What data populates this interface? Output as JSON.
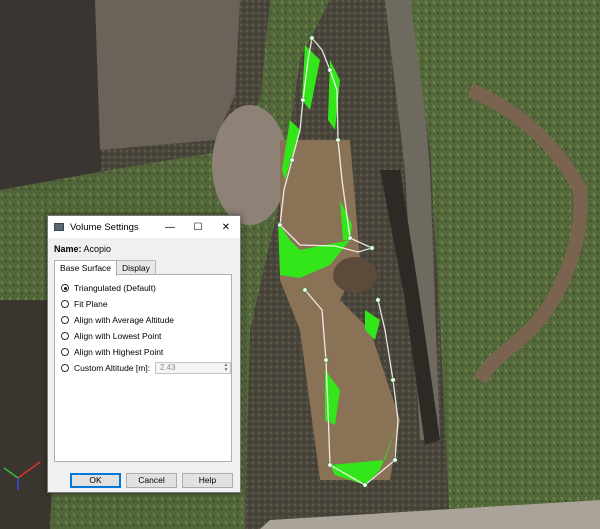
{
  "dialog": {
    "title": "Volume Settings",
    "minimize_glyph": "—",
    "maximize_glyph": "☐",
    "close_glyph": "✕",
    "name_label": "Name:",
    "name_value": "Acopio",
    "tabs": [
      {
        "label": "Base Surface",
        "active": true
      },
      {
        "label": "Display",
        "active": false
      }
    ],
    "options": [
      {
        "label": "Triangulated (Default)",
        "selected": true
      },
      {
        "label": "Fit Plane",
        "selected": false
      },
      {
        "label": "Align with Average Altitude",
        "selected": false
      },
      {
        "label": "Align with Lowest Point",
        "selected": false
      },
      {
        "label": "Align with Highest Point",
        "selected": false
      },
      {
        "label": "Custom Altitude [m]:",
        "selected": false
      }
    ],
    "custom_altitude_value": "2.43",
    "buttons": {
      "ok": "OK",
      "cancel": "Cancel",
      "help": "Help"
    }
  },
  "colors": {
    "volume_fill": "#33e61a",
    "polygon_line": "#ffffff"
  }
}
